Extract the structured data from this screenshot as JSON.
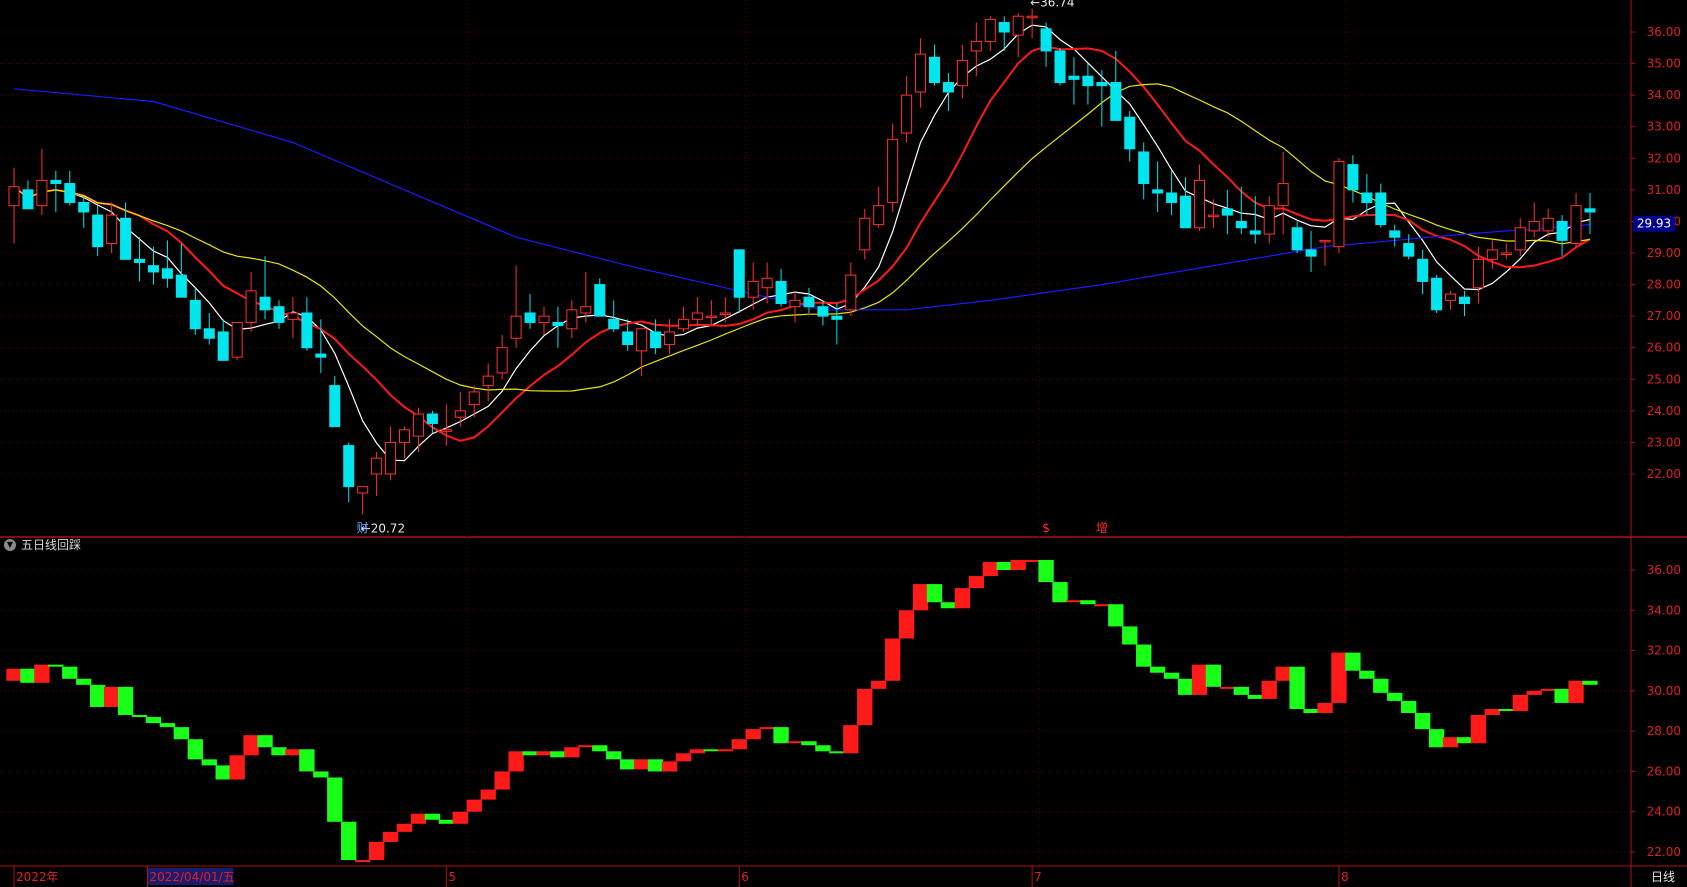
{
  "chart_data": [
    {
      "type": "candlestick",
      "title": "",
      "ylim": [
        20.0,
        37.3
      ],
      "yticks": [
        "22.00",
        "23.00",
        "24.00",
        "25.00",
        "26.00",
        "27.00",
        "28.00",
        "29.00",
        "30.00",
        "31.00",
        "32.00",
        "33.00",
        "34.00",
        "35.00",
        "36.00"
      ],
      "last_price_label": "29.93",
      "high_annotation": "36.74",
      "low_annotation": "20.72",
      "event_markers": [
        "财",
        "$",
        "增"
      ],
      "ohlc": [
        [
          30.5,
          31.7,
          29.3,
          31.1
        ],
        [
          31.0,
          31.3,
          30.4,
          30.4
        ],
        [
          30.5,
          32.3,
          30.2,
          31.3
        ],
        [
          31.3,
          31.6,
          30.3,
          31.2
        ],
        [
          31.2,
          31.6,
          30.5,
          30.6
        ],
        [
          30.6,
          30.8,
          29.8,
          30.3
        ],
        [
          30.2,
          30.5,
          28.9,
          29.2
        ],
        [
          29.3,
          30.6,
          29.0,
          30.2
        ],
        [
          30.1,
          30.6,
          28.8,
          28.8
        ],
        [
          28.8,
          29.5,
          28.1,
          28.7
        ],
        [
          28.6,
          29.2,
          28.0,
          28.4
        ],
        [
          28.5,
          29.4,
          27.9,
          28.2
        ],
        [
          28.3,
          29.3,
          27.8,
          27.6
        ],
        [
          27.5,
          27.9,
          26.4,
          26.6
        ],
        [
          26.6,
          27.1,
          26.1,
          26.3
        ],
        [
          26.5,
          26.9,
          25.6,
          25.6
        ],
        [
          25.7,
          26.8,
          25.6,
          26.8
        ],
        [
          26.8,
          28.4,
          26.5,
          27.8
        ],
        [
          27.6,
          28.9,
          26.9,
          27.2
        ],
        [
          27.3,
          27.5,
          26.6,
          26.8
        ],
        [
          26.9,
          27.6,
          26.3,
          27.1
        ],
        [
          27.1,
          27.6,
          25.9,
          26.0
        ],
        [
          25.8,
          26.9,
          25.2,
          25.7
        ],
        [
          24.8,
          25.1,
          23.5,
          23.5
        ],
        [
          22.9,
          23.0,
          21.1,
          21.6
        ],
        [
          21.4,
          21.6,
          20.72,
          21.6
        ],
        [
          22.0,
          22.7,
          21.3,
          22.5
        ],
        [
          22.0,
          23.5,
          21.8,
          23.0
        ],
        [
          23.0,
          23.5,
          22.5,
          23.4
        ],
        [
          23.2,
          24.1,
          22.7,
          23.9
        ],
        [
          23.9,
          24.0,
          23.3,
          23.6
        ],
        [
          23.4,
          24.2,
          22.9,
          23.4
        ],
        [
          23.8,
          24.6,
          23.5,
          24.0
        ],
        [
          24.2,
          24.8,
          23.8,
          24.6
        ],
        [
          24.8,
          25.5,
          24.3,
          25.1
        ],
        [
          25.2,
          26.4,
          25.0,
          26.0
        ],
        [
          26.3,
          28.6,
          26.0,
          27.0
        ],
        [
          27.1,
          27.7,
          26.6,
          26.8
        ],
        [
          26.8,
          27.3,
          26.4,
          27.0
        ],
        [
          26.8,
          27.3,
          26.0,
          26.7
        ],
        [
          26.6,
          27.5,
          26.3,
          27.2
        ],
        [
          27.1,
          28.4,
          26.8,
          27.3
        ],
        [
          28.0,
          28.2,
          27.0,
          27.0
        ],
        [
          26.9,
          27.5,
          26.5,
          26.6
        ],
        [
          26.5,
          26.9,
          25.9,
          26.1
        ],
        [
          25.9,
          26.6,
          25.1,
          26.6
        ],
        [
          26.5,
          26.9,
          25.8,
          26.0
        ],
        [
          26.1,
          26.9,
          25.8,
          26.5
        ],
        [
          26.6,
          27.3,
          26.5,
          26.9
        ],
        [
          26.9,
          27.6,
          26.7,
          27.1
        ],
        [
          27.0,
          27.5,
          26.7,
          27.0
        ],
        [
          27.1,
          27.6,
          26.8,
          27.1
        ],
        [
          29.1,
          29.1,
          27.1,
          27.6
        ],
        [
          27.6,
          28.7,
          27.2,
          28.1
        ],
        [
          27.9,
          28.7,
          27.4,
          28.2
        ],
        [
          28.1,
          28.5,
          27.3,
          27.4
        ],
        [
          27.3,
          27.8,
          26.8,
          27.5
        ],
        [
          27.6,
          27.9,
          27.1,
          27.3
        ],
        [
          27.3,
          27.5,
          26.7,
          27.0
        ],
        [
          27.0,
          27.4,
          26.1,
          26.9
        ],
        [
          27.2,
          28.7,
          27.0,
          28.3
        ],
        [
          29.1,
          30.4,
          28.8,
          30.1
        ],
        [
          29.9,
          31.1,
          29.8,
          30.5
        ],
        [
          30.6,
          33.1,
          30.3,
          32.6
        ],
        [
          32.8,
          34.6,
          32.5,
          34.0
        ],
        [
          34.1,
          35.8,
          33.6,
          35.3
        ],
        [
          35.2,
          35.6,
          34.3,
          34.4
        ],
        [
          34.4,
          34.7,
          33.5,
          34.1
        ],
        [
          34.3,
          35.6,
          33.9,
          35.1
        ],
        [
          35.4,
          36.3,
          34.6,
          35.7
        ],
        [
          35.7,
          36.5,
          35.4,
          36.4
        ],
        [
          36.3,
          36.5,
          35.4,
          36.0
        ],
        [
          35.9,
          36.6,
          35.2,
          36.5
        ],
        [
          36.5,
          36.74,
          35.8,
          36.5
        ],
        [
          36.1,
          36.3,
          34.9,
          35.4
        ],
        [
          35.4,
          35.5,
          34.3,
          34.4
        ],
        [
          34.6,
          35.2,
          33.7,
          34.5
        ],
        [
          34.6,
          35.0,
          33.7,
          34.3
        ],
        [
          34.4,
          34.8,
          33.0,
          34.3
        ],
        [
          34.4,
          35.4,
          33.3,
          33.2
        ],
        [
          33.3,
          33.5,
          31.9,
          32.3
        ],
        [
          32.2,
          32.5,
          30.7,
          31.2
        ],
        [
          31.0,
          31.9,
          30.3,
          30.9
        ],
        [
          30.9,
          31.6,
          30.2,
          30.6
        ],
        [
          30.8,
          31.4,
          29.8,
          29.8
        ],
        [
          29.8,
          31.8,
          29.7,
          31.3
        ],
        [
          30.2,
          30.7,
          29.8,
          30.2
        ],
        [
          30.4,
          31.0,
          29.6,
          30.2
        ],
        [
          30.0,
          31.1,
          29.6,
          29.8
        ],
        [
          29.7,
          30.8,
          29.3,
          29.6
        ],
        [
          29.6,
          30.8,
          29.3,
          30.5
        ],
        [
          30.5,
          32.2,
          29.6,
          31.2
        ],
        [
          29.8,
          30.0,
          29.0,
          29.1
        ],
        [
          29.1,
          29.7,
          28.4,
          28.9
        ],
        [
          29.4,
          29.4,
          28.6,
          29.4
        ],
        [
          29.2,
          32.0,
          29.0,
          31.9
        ],
        [
          31.8,
          32.1,
          30.6,
          31.0
        ],
        [
          30.9,
          31.5,
          30.2,
          30.6
        ],
        [
          30.9,
          31.2,
          29.8,
          29.9
        ],
        [
          29.7,
          29.9,
          29.2,
          29.5
        ],
        [
          29.3,
          29.6,
          28.8,
          28.9
        ],
        [
          28.8,
          29.1,
          27.7,
          28.1
        ],
        [
          28.2,
          28.3,
          27.1,
          27.2
        ],
        [
          27.5,
          27.8,
          27.2,
          27.7
        ],
        [
          27.6,
          27.8,
          27.0,
          27.4
        ],
        [
          27.9,
          29.2,
          27.4,
          28.8
        ],
        [
          28.8,
          29.4,
          28.5,
          29.1
        ],
        [
          29.0,
          29.3,
          28.8,
          29.0
        ],
        [
          29.1,
          30.1,
          28.9,
          29.8
        ],
        [
          29.7,
          30.6,
          29.5,
          30.0
        ],
        [
          29.7,
          30.4,
          29.5,
          30.1
        ],
        [
          30.0,
          30.2,
          28.9,
          29.4
        ],
        [
          29.3,
          30.9,
          29.2,
          30.5
        ],
        [
          30.4,
          30.9,
          29.6,
          30.3
        ]
      ],
      "ma_lines": [
        {
          "color": "#ffffff",
          "period": 5
        },
        {
          "color": "#ff1a1a",
          "period": 10
        },
        {
          "color": "#e6e600",
          "period": 20
        },
        {
          "color": "#1a1aff",
          "period": 60
        }
      ],
      "ma60_points": [
        [
          0,
          34.2
        ],
        [
          10,
          33.8
        ],
        [
          20,
          32.5
        ],
        [
          28,
          31.0
        ],
        [
          36,
          29.5
        ],
        [
          44,
          28.6
        ],
        [
          52,
          27.8
        ],
        [
          58,
          27.2
        ],
        [
          64,
          27.2
        ],
        [
          70,
          27.5
        ],
        [
          78,
          28.0
        ],
        [
          86,
          28.6
        ],
        [
          94,
          29.2
        ],
        [
          104,
          29.6
        ],
        [
          113,
          29.9
        ]
      ],
      "x_date_labels": [
        "2022年",
        "2022/04/01/五",
        "5",
        "6",
        "7",
        "8"
      ],
      "period_label": "日线"
    },
    {
      "type": "boxes",
      "indicator_name": "五日线回踩",
      "ylim": [
        21.3,
        37.2
      ],
      "yticks": [
        "22.00",
        "24.00",
        "26.00",
        "28.00",
        "30.00",
        "32.00",
        "34.00",
        "36.00"
      ]
    }
  ]
}
